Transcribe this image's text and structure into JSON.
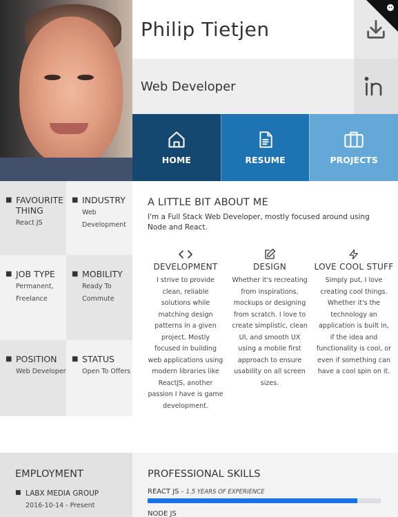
{
  "profile": {
    "name": "Philip Tietjen",
    "title": "Web Developer"
  },
  "nav": {
    "home": "HOME",
    "resume": "RESUME",
    "projects": "PROJECTS"
  },
  "facts": [
    {
      "label": "FAVOURITE THING",
      "value": "React JS"
    },
    {
      "label": "INDUSTRY",
      "value": "Web Development"
    },
    {
      "label": "JOB TYPE",
      "value": "Permanent, Freelance"
    },
    {
      "label": "MOBILITY",
      "value": "Ready To Commute"
    },
    {
      "label": "POSITION",
      "value": "Web Developer"
    },
    {
      "label": "STATUS",
      "value": "Open To Offers"
    }
  ],
  "about": {
    "heading": "A LITTLE BIT ABOUT ME",
    "intro": "I'm a Full Stack Web Developer, mostly focused around using Node and React.",
    "features": [
      {
        "icon": "code-icon",
        "title": "DEVELOPMENT",
        "text": "I strive to provide clean, reliable solutions while matching design patterns in a given project. Mostly focused in building web applications using modern libraries like ReactJS, another passion I have is game development."
      },
      {
        "icon": "edit-icon",
        "title": "DESIGN",
        "text": "Whether it's recreating from inspirations, mockups or designing from scratch. I love to create simplistic, clean UI, and smooth UX using a mobile first approach to ensure usability on all screen sizes."
      },
      {
        "icon": "lightning-icon",
        "title": "LOVE COOL STUFF",
        "text": "Simply put, I love creating cool things. Whether it's the technology an application is built in, if the idea and functionality is cool, or even if something can have a cool spin on it."
      }
    ]
  },
  "employment": {
    "heading": "EMPLOYMENT",
    "jobs": [
      {
        "company": "LABX MEDIA GROUP",
        "dates": "2016-10-14 - Present"
      }
    ]
  },
  "skills": {
    "heading": "PROFESSIONAL SKILLS",
    "items": [
      {
        "name": "REACT JS",
        "separator": " - ",
        "experience": "1.5 YEARS OF EXPERIENCE",
        "level": 0.9
      },
      {
        "name": "NODE JS",
        "separator": "",
        "experience": "",
        "level": 0
      }
    ]
  },
  "colors": {
    "nav_home": "#154870",
    "nav_resume": "#1e74b3",
    "nav_projects": "#63a8d6",
    "skill_bar": "#1673e8"
  },
  "icons": {
    "download": "download-icon",
    "linkedin": "linkedin-icon",
    "github": "github-corner-icon",
    "home": "home-icon",
    "resume": "document-icon",
    "projects": "briefcase-icon"
  }
}
